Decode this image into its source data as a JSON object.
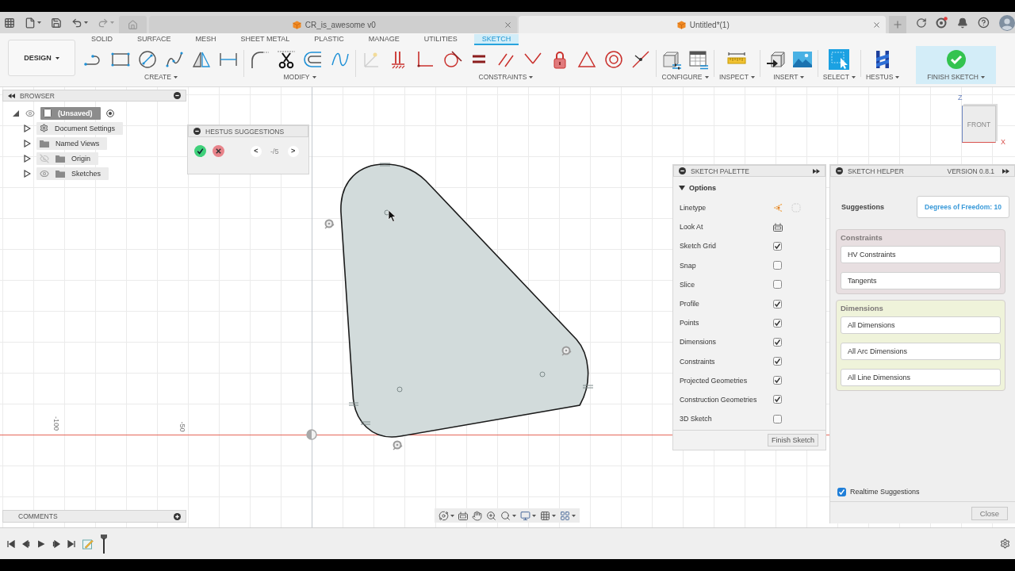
{
  "title_bar": {
    "tabs": [
      {
        "label": "CR_is_awesome v0",
        "selected": false
      },
      {
        "label": "Untitled*(1)",
        "selected": true
      }
    ]
  },
  "toolbar": {
    "workspace": "DESIGN",
    "tabs": [
      {
        "label": "SOLID",
        "selected": false
      },
      {
        "label": "SURFACE",
        "selected": false
      },
      {
        "label": "MESH",
        "selected": false
      },
      {
        "label": "SHEET METAL",
        "selected": false
      },
      {
        "label": "PLASTIC",
        "selected": false
      },
      {
        "label": "MANAGE",
        "selected": false
      },
      {
        "label": "UTILITIES",
        "selected": false
      },
      {
        "label": "SKETCH",
        "selected": true
      }
    ],
    "groups": [
      {
        "label": "CREATE",
        "kind": "create"
      },
      {
        "label": "MODIFY",
        "kind": "modify"
      },
      {
        "label": "CONSTRAINTS",
        "kind": "constraints"
      },
      {
        "label": "CONFIGURE",
        "kind": "configure"
      },
      {
        "label": "INSPECT",
        "kind": "inspect"
      },
      {
        "label": "INSERT",
        "kind": "insert"
      },
      {
        "label": "SELECT",
        "kind": "select"
      },
      {
        "label": "HESTUS",
        "kind": "hestus"
      },
      {
        "label": "FINISH SKETCH",
        "kind": "finish"
      }
    ]
  },
  "browser": {
    "title": "BROWSER",
    "root": {
      "label": "(Unsaved)",
      "selected": true,
      "expanded": true,
      "visible": true,
      "children": [
        {
          "label": "Document Settings",
          "kind": "settings",
          "selected": false,
          "expanded": false
        },
        {
          "label": "Named Views",
          "kind": "folder",
          "selected": false,
          "expanded": false
        },
        {
          "label": "Origin",
          "kind": "folder",
          "selected": false,
          "expanded": false,
          "visible": false
        },
        {
          "label": "Sketches",
          "kind": "folder",
          "selected": false,
          "expanded": false,
          "visible": true
        }
      ]
    }
  },
  "hestus_suggestions": {
    "title": "HESTUS SUGGESTIONS",
    "prev": "<",
    "counter": "-/5",
    "next": ">"
  },
  "canvas": {
    "axis_labels": [
      "-100",
      "-50"
    ]
  },
  "view_cube": {
    "face": "FRONT",
    "axes": [
      "Z",
      "X"
    ]
  },
  "sketch_palette": {
    "title": "SKETCH PALETTE",
    "section": {
      "label": "Options",
      "expanded": true
    },
    "rows": [
      {
        "label": "Linetype",
        "kind": "linetype"
      },
      {
        "label": "Look At",
        "kind": "look_at"
      },
      {
        "label": "Sketch Grid",
        "kind": "checkbox",
        "checked": true
      },
      {
        "label": "Snap",
        "kind": "checkbox",
        "checked": false
      },
      {
        "label": "Slice",
        "kind": "checkbox",
        "checked": false
      },
      {
        "label": "Profile",
        "kind": "checkbox",
        "checked": true
      },
      {
        "label": "Points",
        "kind": "checkbox",
        "checked": true
      },
      {
        "label": "Dimensions",
        "kind": "checkbox",
        "checked": true
      },
      {
        "label": "Constraints",
        "kind": "checkbox",
        "checked": true
      },
      {
        "label": "Projected Geometries",
        "kind": "checkbox",
        "checked": true
      },
      {
        "label": "Construction Geometries",
        "kind": "checkbox",
        "checked": true
      },
      {
        "label": "3D Sketch",
        "kind": "checkbox",
        "checked": false
      }
    ],
    "button": "Finish Sketch"
  },
  "sketch_helper": {
    "title": "SKETCH HELPER",
    "version": "VERSION 0.8.1",
    "suggestions_label": "Suggestions",
    "degrees_of_freedom": "Degrees of Freedom: 10",
    "groups": [
      {
        "title": "Constraints",
        "color": "#e8dfe1",
        "items": [
          "HV Constraints",
          "Tangents"
        ]
      },
      {
        "title": "Dimensions",
        "color": "#eff3da",
        "items": [
          "All Dimensions",
          "All Arc Dimensions",
          "All Line Dimensions"
        ]
      }
    ],
    "realtime_suggestions": {
      "label": "Realtime Suggestions",
      "checked": true
    },
    "close": "Close"
  },
  "comments": {
    "title": "COMMENTS"
  }
}
